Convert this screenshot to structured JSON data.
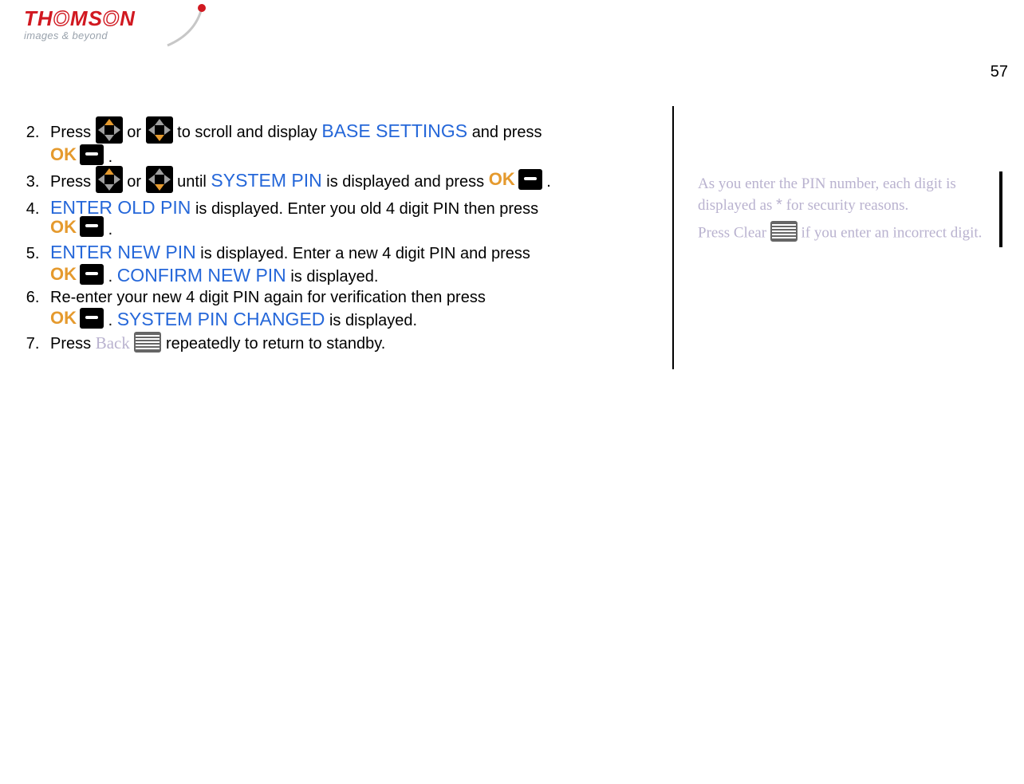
{
  "header": {
    "brand_letters": [
      "T",
      "H",
      "O",
      "M",
      "S",
      "O",
      "N"
    ],
    "tagline": "images & beyond",
    "page_number": "57"
  },
  "steps": {
    "start_index": 2,
    "s2": {
      "a": "Press ",
      "b": " or ",
      "c": " to scroll and display ",
      "term": "BASE SETTINGS",
      "d": " and press ",
      "ok": "OK",
      "e": "."
    },
    "s3": {
      "a": "Press ",
      "b": " or ",
      "c": " until ",
      "term": "SYSTEM PIN",
      "d": " is displayed and press ",
      "ok": "OK",
      "e": "."
    },
    "s4": {
      "term": "ENTER OLD PIN",
      "a": " is displayed.  Enter you old 4 digit PIN then press ",
      "ok": "OK",
      "b": "."
    },
    "s5": {
      "term1": "ENTER NEW PIN",
      "a": " is displayed.  Enter a new 4 digit PIN and press ",
      "ok": "OK",
      "b": ". ",
      "term2": "CONFIRM NEW PIN",
      "c": " is displayed."
    },
    "s6": {
      "a": "Re-enter your new 4 digit PIN again for verification then press ",
      "ok": "OK",
      "b": ". ",
      "term": "SYSTEM PIN CHANGED",
      "c": " is displayed."
    },
    "s7": {
      "a": "Press ",
      "back": "Back",
      "b": " repeatedly to return to standby."
    }
  },
  "sidebar": {
    "p1a": "As you enter the PIN number, each digit is displayed as ",
    "asterisk": "*",
    "p1b": " for security reasons.",
    "p2a": "Press ",
    "clear": "Clear",
    "p2b": " if you enter an incorrect digit."
  }
}
